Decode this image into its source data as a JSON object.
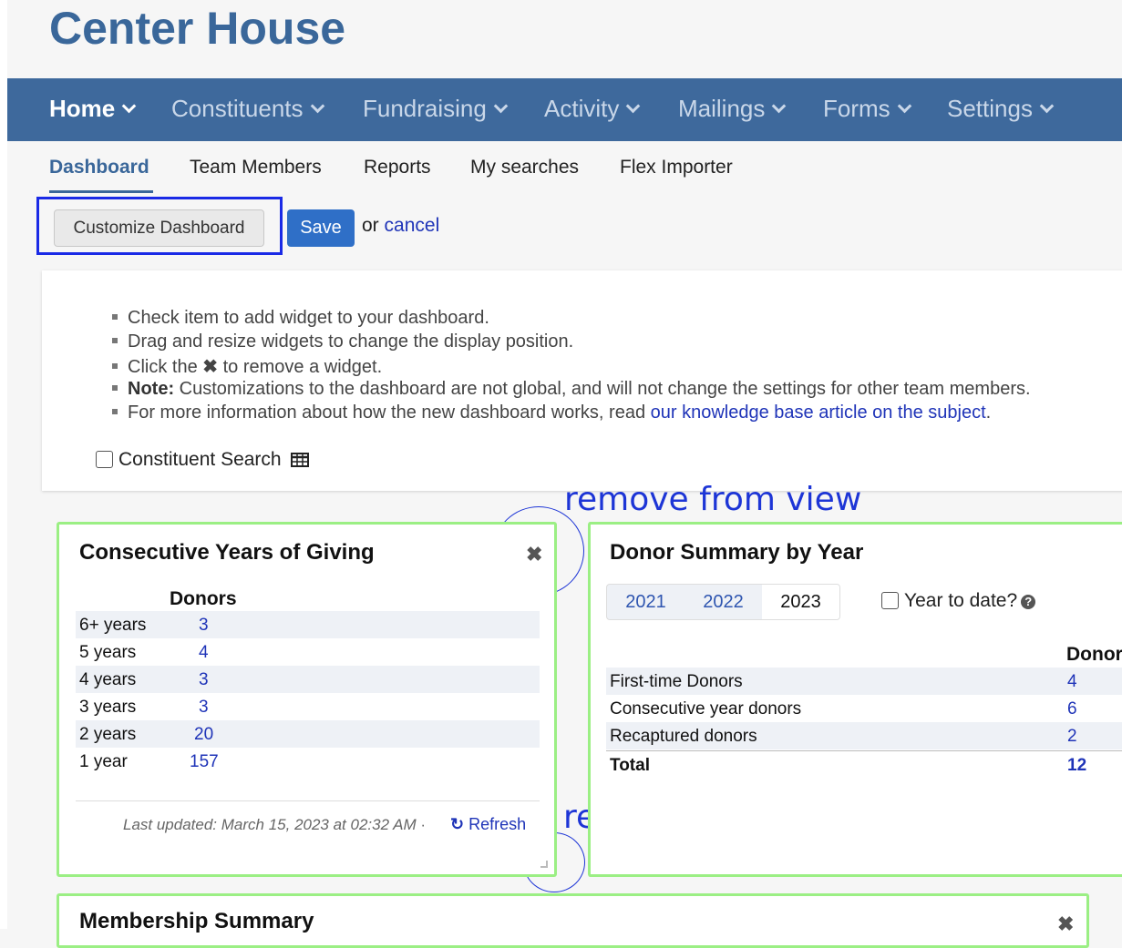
{
  "app": {
    "title": "Center House"
  },
  "main_nav": [
    {
      "label": "Home",
      "active": true
    },
    {
      "label": "Constituents",
      "active": false
    },
    {
      "label": "Fundraising",
      "active": false
    },
    {
      "label": "Activity",
      "active": false
    },
    {
      "label": "Mailings",
      "active": false
    },
    {
      "label": "Forms",
      "active": false
    },
    {
      "label": "Settings",
      "active": false
    }
  ],
  "sub_nav": [
    {
      "label": "Dashboard",
      "active": true
    },
    {
      "label": "Team Members",
      "active": false
    },
    {
      "label": "Reports",
      "active": false
    },
    {
      "label": "My searches",
      "active": false
    },
    {
      "label": "Flex Importer",
      "active": false
    }
  ],
  "toolbar": {
    "customize_label": "Customize Dashboard",
    "save_label": "Save",
    "or_text": "or",
    "cancel_label": "cancel"
  },
  "info": {
    "bullets": [
      "Check item to add widget to your dashboard.",
      "Drag and resize widgets to change the display position.",
      "Click the",
      "to remove a widget.",
      "Note:",
      "Customizations to the dashboard are not global, and will not change the settings for other team members.",
      "For more information about how the new dashboard works, read",
      "our knowledge base article on the subject",
      "."
    ],
    "checkbox_label": "Constituent Search"
  },
  "annotations": {
    "remove": "remove from view",
    "resize": "re-size"
  },
  "widgets": {
    "consecutive": {
      "title": "Consecutive Years of Giving",
      "column_header": "Donors",
      "rows": [
        {
          "label": "6+ years",
          "value": "3"
        },
        {
          "label": "5 years",
          "value": "4"
        },
        {
          "label": "4 years",
          "value": "3"
        },
        {
          "label": "3 years",
          "value": "3"
        },
        {
          "label": "2 years",
          "value": "20"
        },
        {
          "label": "1 year",
          "value": "157"
        }
      ],
      "last_updated": "Last updated: March 15, 2023 at 02:32 AM",
      "separator": "·",
      "refresh_label": "Refresh"
    },
    "donor_summary": {
      "title": "Donor Summary by Year",
      "years": [
        "2021",
        "2022",
        "2023"
      ],
      "selected_year": "2023",
      "ytd_label": "Year to date?",
      "column_header": "Donor",
      "rows": [
        {
          "label": "First-time Donors",
          "value": "4"
        },
        {
          "label": "Consecutive year donors",
          "value": "6"
        },
        {
          "label": "Recaptured donors",
          "value": "2"
        }
      ],
      "total_label": "Total",
      "total_value": "12"
    },
    "membership": {
      "title": "Membership Summary"
    }
  },
  "icons": {
    "close": "close-icon",
    "refresh": "refresh-icon",
    "help": "help-icon",
    "grid": "table-icon",
    "chevron": "chevron-down-icon"
  },
  "colors": {
    "brand": "#3a679a",
    "nav_bg": "#3e699c",
    "link": "#1f34b8",
    "save_button": "#2f6fc7",
    "widget_border": "#9bef84",
    "annotation": "#1d35d6"
  }
}
